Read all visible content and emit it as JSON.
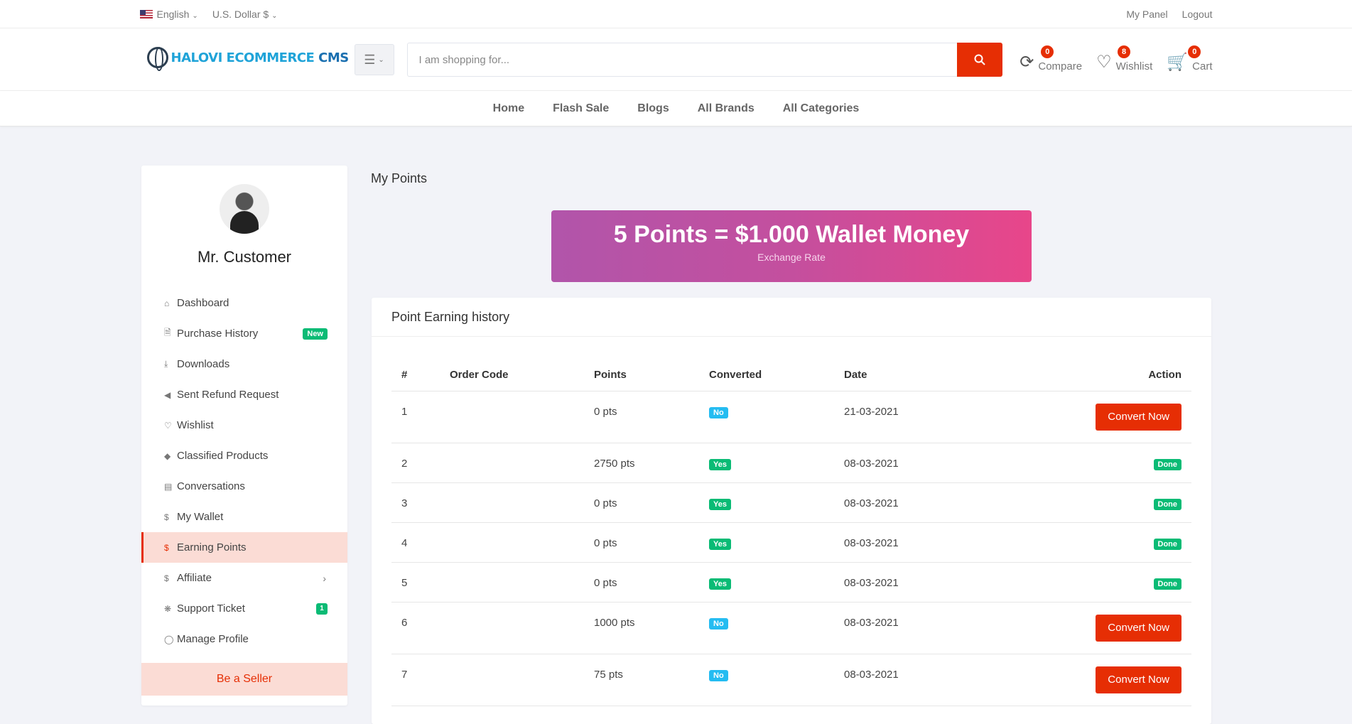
{
  "topbar": {
    "language": "English",
    "currency": "U.S. Dollar $",
    "my_panel": "My Panel",
    "logout": "Logout"
  },
  "header": {
    "logo_part1": "HALOVI ECOMMERCE ",
    "logo_part2": "CMS",
    "search_placeholder": "I am shopping for...",
    "compare": {
      "label": "Compare",
      "count": "0"
    },
    "wishlist": {
      "label": "Wishlist",
      "count": "8"
    },
    "cart": {
      "label": "Cart",
      "count": "0"
    }
  },
  "nav": [
    "Home",
    "Flash Sale",
    "Blogs",
    "All Brands",
    "All Categories"
  ],
  "sidebar": {
    "name": "Mr. Customer",
    "items": [
      {
        "label": "Dashboard",
        "icon": "home-icon"
      },
      {
        "label": "Purchase History",
        "icon": "file-icon",
        "tag": "New"
      },
      {
        "label": "Downloads",
        "icon": "download-icon"
      },
      {
        "label": "Sent Refund Request",
        "icon": "backward-icon"
      },
      {
        "label": "Wishlist",
        "icon": "heart-icon"
      },
      {
        "label": "Classified Products",
        "icon": "diamond-icon"
      },
      {
        "label": "Conversations",
        "icon": "chat-icon"
      },
      {
        "label": "My Wallet",
        "icon": "dollar-icon"
      },
      {
        "label": "Earning Points",
        "icon": "dollar-icon"
      },
      {
        "label": "Affiliate",
        "icon": "dollar-icon"
      },
      {
        "label": "Support Ticket",
        "icon": "support-icon",
        "count": "1"
      },
      {
        "label": "Manage Profile",
        "icon": "user-icon"
      }
    ],
    "be_seller": "Be a Seller"
  },
  "main": {
    "title": "My Points",
    "rate": "5 Points = $1.000 Wallet Money",
    "rate_caption": "Exchange Rate",
    "history_title": "Point Earning history",
    "columns": [
      "#",
      "Order Code",
      "Points",
      "Converted",
      "Date",
      "Action"
    ],
    "rows": [
      {
        "n": "1",
        "order": "",
        "points": "0 pts",
        "converted": "No",
        "date": "21-03-2021",
        "action": "Convert Now"
      },
      {
        "n": "2",
        "order": "",
        "points": "2750 pts",
        "converted": "Yes",
        "date": "08-03-2021",
        "action": "Done"
      },
      {
        "n": "3",
        "order": "",
        "points": "0 pts",
        "converted": "Yes",
        "date": "08-03-2021",
        "action": "Done"
      },
      {
        "n": "4",
        "order": "",
        "points": "0 pts",
        "converted": "Yes",
        "date": "08-03-2021",
        "action": "Done"
      },
      {
        "n": "5",
        "order": "",
        "points": "0 pts",
        "converted": "Yes",
        "date": "08-03-2021",
        "action": "Done"
      },
      {
        "n": "6",
        "order": "",
        "points": "1000 pts",
        "converted": "No",
        "date": "08-03-2021",
        "action": "Convert Now"
      },
      {
        "n": "7",
        "order": "",
        "points": "75 pts",
        "converted": "No",
        "date": "08-03-2021",
        "action": "Convert Now"
      }
    ]
  },
  "colors": {
    "accent": "#e62e04",
    "success": "#0abb75",
    "info": "#25bcf1"
  }
}
